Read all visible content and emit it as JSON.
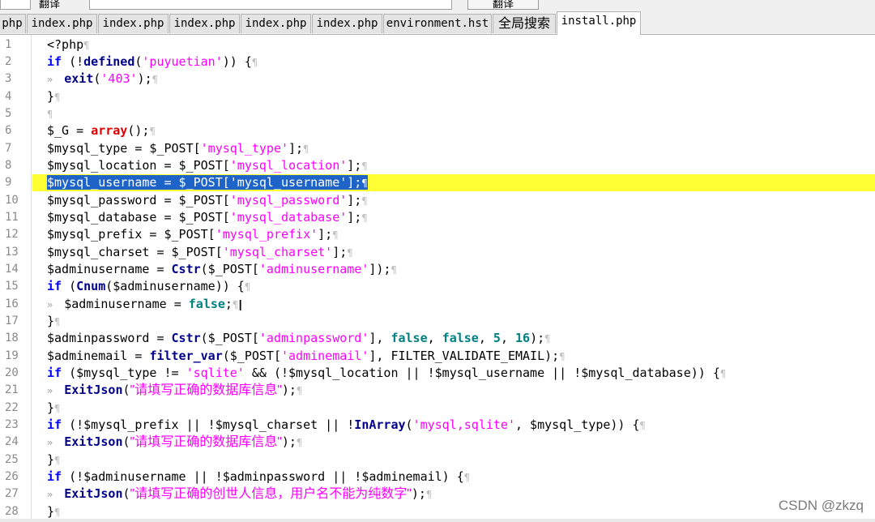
{
  "toolbar": {
    "label": "翻译",
    "button_label": "翻译"
  },
  "tabs": [
    "php",
    "index.php",
    "index.php",
    "index.php",
    "index.php",
    "index.php",
    "environment.hst",
    "全局搜索",
    "install.php"
  ],
  "active_tab": "install.php",
  "line_numbers": [
    "1",
    "2",
    "3",
    "4",
    "5",
    "6",
    "7",
    "8",
    "9",
    "10",
    "11",
    "12",
    "13",
    "14",
    "15",
    "16",
    "17",
    "18",
    "19",
    "20",
    "21",
    "22",
    "23",
    "24",
    "25",
    "26",
    "27",
    "28"
  ],
  "code_lines": [
    "<?php",
    "if (!defined('puyuetian')) {",
    "exit('403');",
    "}",
    "",
    "$_G = array();",
    "$mysql_type = $_POST['mysql_type'];",
    "$mysql_location = $_POST['mysql_location'];",
    "$mysql_username = $_POST['mysql_username'];",
    "$mysql_password = $_POST['mysql_password'];",
    "$mysql_database = $_POST['mysql_database'];",
    "$mysql_prefix = $_POST['mysql_prefix'];",
    "$mysql_charset = $_POST['mysql_charset'];",
    "$adminusername = Cstr($_POST['adminusername']);",
    "if (Cnum($adminusername)) {",
    "$adminusername = false;",
    "}",
    "$adminpassword = Cstr($_POST['adminpassword'], false, false, 5, 16);",
    "$adminemail = filter_var($_POST['adminemail'], FILTER_VALIDATE_EMAIL);",
    "if ($mysql_type != 'sqlite' && (!$mysql_location || !$mysql_username || !$mysql_database)) {",
    "ExitJson(\"请填写正确的数据库信息\");",
    "}",
    "if (!$mysql_prefix || !$mysql_charset || !InArray('mysql,sqlite', $mysql_type)) {",
    "ExitJson(\"请填写正确的数据库信息\");",
    "}",
    "if (!$adminusername || !$adminpassword || !$adminemail) {",
    "ExitJson(\"请填写正确的创世人信息，用户名不能为纯数字\");",
    "}"
  ],
  "highlighted_line": 9,
  "eol_marker": "¶",
  "indent_marker": "»",
  "watermark": "CSDN @zkzq",
  "colors": {
    "keyword": "#0000ff",
    "string": "#ff00ff",
    "red_builtin": "#e00000",
    "boolean_number": "#008080",
    "line_highlight": "#ffff33",
    "selection": "#1e64c8"
  },
  "icons": [
    "text-cursor-icon"
  ]
}
